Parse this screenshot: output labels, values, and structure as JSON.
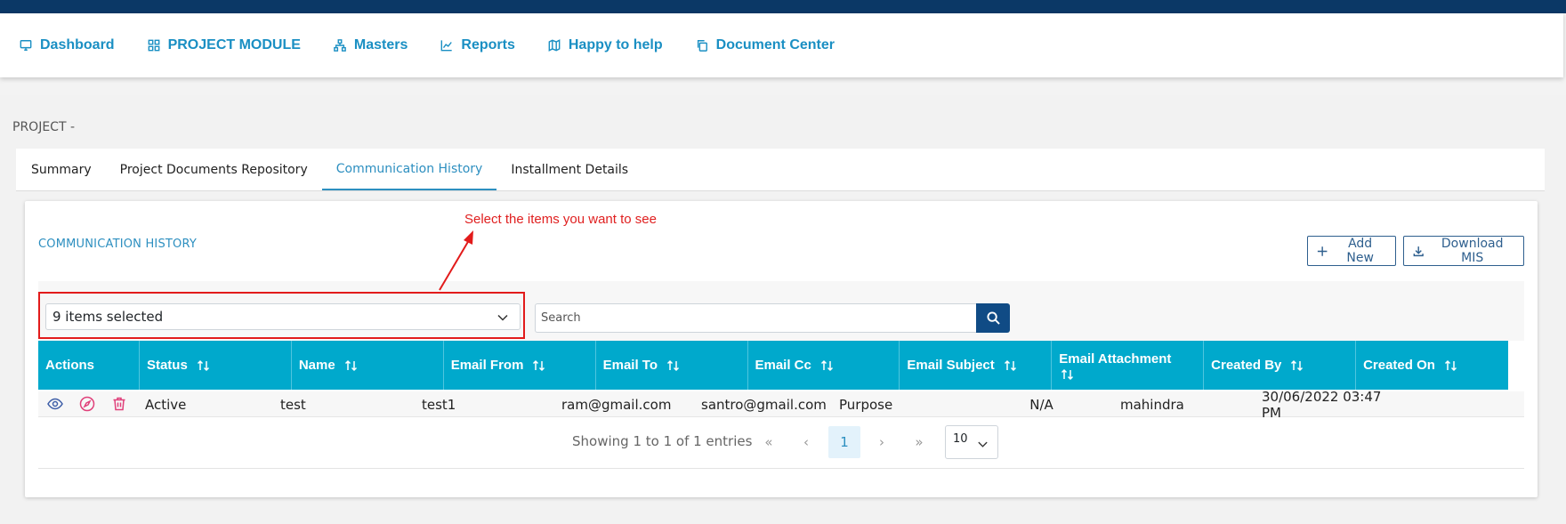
{
  "nav": {
    "items": [
      {
        "label": "Dashboard",
        "icon": "monitor-icon"
      },
      {
        "label": "PROJECT MODULE",
        "icon": "grid-icon"
      },
      {
        "label": "Masters",
        "icon": "sitemap-icon"
      },
      {
        "label": "Reports",
        "icon": "chart-line-icon"
      },
      {
        "label": "Happy to help",
        "icon": "map-icon"
      },
      {
        "label": "Document Center",
        "icon": "copy-icon"
      }
    ]
  },
  "page": {
    "project_label": "PROJECT -"
  },
  "tabs": [
    {
      "label": "Summary",
      "active": false
    },
    {
      "label": "Project Documents Repository",
      "active": false
    },
    {
      "label": "Communication History",
      "active": true
    },
    {
      "label": "Installment Details",
      "active": false
    }
  ],
  "section": {
    "title": "COMMUNICATION HISTORY"
  },
  "annotation": {
    "text": "Select the items you want to see"
  },
  "buttons": {
    "add_new": "Add New",
    "download_mis": "Download MIS"
  },
  "filter": {
    "selected_value": "9 items selected",
    "search_placeholder": "Search"
  },
  "table": {
    "headers": {
      "actions": "Actions",
      "status": "Status",
      "name": "Name",
      "email_from": "Email From",
      "email_to": "Email To",
      "email_cc": "Email Cc",
      "email_subject": "Email Subject",
      "email_attachment": "Email Attachment",
      "created_by": "Created By",
      "created_on": "Created On"
    },
    "rows": [
      {
        "status": "Active",
        "name": "test",
        "email_from": "test1",
        "email_to": "ram@gmail.com",
        "email_cc": "santro@gmail.com",
        "email_subject": "Purpose",
        "email_attachment": "N/A",
        "created_by": "mahindra",
        "created_on": "30/06/2022 03:47 PM"
      }
    ]
  },
  "pagination": {
    "info": "Showing 1 to 1 of 1 entries",
    "first": "«",
    "prev": "‹",
    "current_page": "1",
    "next": "›",
    "last": "»",
    "page_size": "10"
  },
  "colors": {
    "topbar": "#0b3866",
    "nav_text": "#1a8fc3",
    "table_header": "#00a9cc",
    "accent": "#2d8fc0",
    "annotation": "#e21b1b",
    "search_button": "#104b85"
  }
}
